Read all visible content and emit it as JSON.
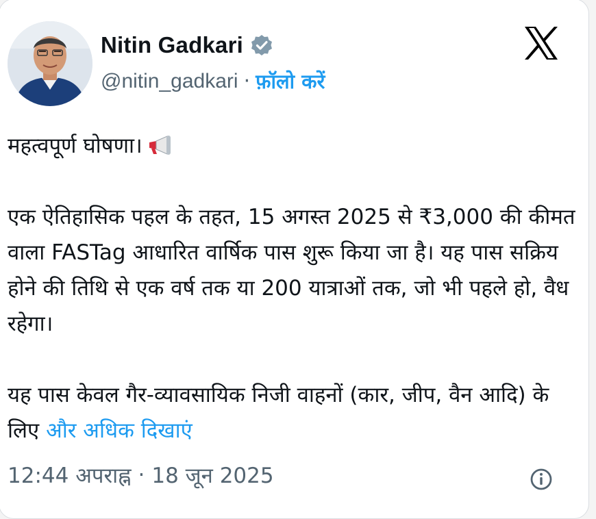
{
  "author": {
    "name": "Nitin Gadkari",
    "handle": "@nitin_gadkari",
    "separator": "·",
    "follow_label": "फ़ॉलो करें",
    "verified": true
  },
  "icons": {
    "logo": "x-logo-icon",
    "verified": "verified-badge-icon",
    "emoji": "megaphone-icon",
    "info": "info-icon"
  },
  "post": {
    "line1": "महत्वपूर्ण घोषणा।",
    "paragraph2": "एक ऐतिहासिक पहल के तहत, 15 अगस्त 2025 से ₹3,000 की कीमत वाला FASTag आधारित वार्षिक पास शुरू किया जा है। यह पास सक्रिय होने की तिथि से एक वर्ष तक या 200 यात्राओं तक, जो भी पहले हो, वैध रहेगा।",
    "paragraph3": "यह पास केवल गैर-व्यावसायिक निजी वाहनों (कार, जीप, वैन आदि) के लिए",
    "show_more_label": "और अधिक दिखाएं"
  },
  "timestamp": {
    "time": "12:44 अपराह्न",
    "separator": "·",
    "date": "18 जून 2025"
  },
  "colors": {
    "link": "#1d9bf0",
    "text": "#0f1419",
    "secondary": "#536471",
    "background": "#ffffff"
  }
}
